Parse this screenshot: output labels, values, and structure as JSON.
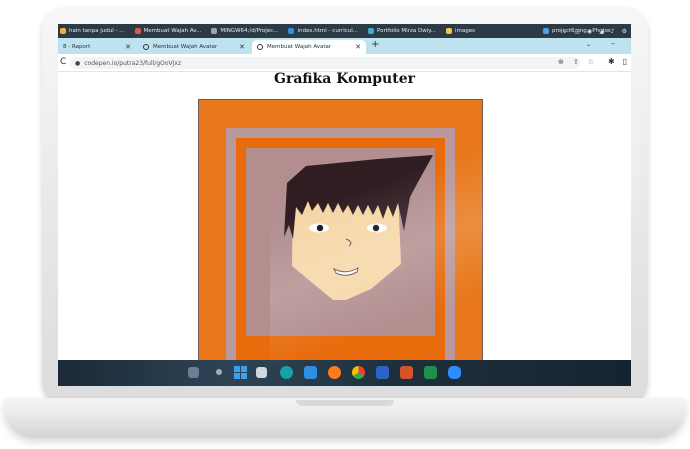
{
  "bookmarks_bar": {
    "items": [
      {
        "label": "hain tanpa judul - ...",
        "color": "#f2b233"
      },
      {
        "label": "Membuat Wajah Av...",
        "color": "#e0584a"
      },
      {
        "label": "MINGW64:/d/Projec...",
        "color": "#9aa7b0"
      },
      {
        "label": "index.html - curricul...",
        "color": "#2f8fe0"
      },
      {
        "label": "Portfolio Mirza Dwiy...",
        "color": "#3bb0c8"
      },
      {
        "label": "images",
        "color": "#f4c84a"
      },
      {
        "label": "project6.png - Photos",
        "color": "#4aa3e8"
      }
    ],
    "system_icons": [
      "⌄",
      "▢",
      "◉",
      "◢",
      "♪",
      "⚙"
    ]
  },
  "tabs": [
    {
      "label": "8 - Raport",
      "close": "✕"
    },
    {
      "label": "Membuat Wajah Avatar",
      "close": "✕"
    },
    {
      "label": "Membuat Wajah Avatar",
      "close": "✕"
    }
  ],
  "tab_controls": {
    "new_tab": "+",
    "dropdown": "⌄",
    "minimize": "–"
  },
  "toolbar": {
    "reload": "C",
    "url": "codepen.io/putra23/full/gOoVJxz",
    "zoom_icon": "⊕",
    "share_icon": "⇪",
    "star_icon": "☆",
    "extensions_icon": "✱",
    "sidebar_icon": "▯"
  },
  "page": {
    "title": "Grafika Komputer"
  },
  "avatar": {
    "colors": {
      "frame_border": "#6f5a5a",
      "outer_orange": "#e8771c",
      "mauve": "#b9999b",
      "inner_orange": "#e86c0c",
      "inner_mauve": "#b28e8f",
      "skin": "#f6d6a6",
      "hair": "#2f1d22",
      "eye_white": "#ffffff",
      "pupil": "#111111",
      "mouth_fill": "#ffffff",
      "mouth_line": "#6a4a4a"
    }
  },
  "taskbar": {
    "apps": [
      {
        "name": "widgets",
        "color": "#6a7f94"
      },
      {
        "name": "start",
        "color": "#3aa0f0"
      },
      {
        "name": "task-view",
        "color": "#cfd8de"
      },
      {
        "name": "arduino",
        "color": "#17a2a8"
      },
      {
        "name": "vscode",
        "color": "#2d8fe0"
      },
      {
        "name": "firefox",
        "color": "#ff7a1a"
      },
      {
        "name": "chrome",
        "color": "#e8b92a"
      },
      {
        "name": "word",
        "color": "#2b66c7"
      },
      {
        "name": "powerpoint",
        "color": "#d5532b"
      },
      {
        "name": "excel",
        "color": "#1f8f4e"
      },
      {
        "name": "zoom",
        "color": "#2d8cff"
      }
    ]
  }
}
